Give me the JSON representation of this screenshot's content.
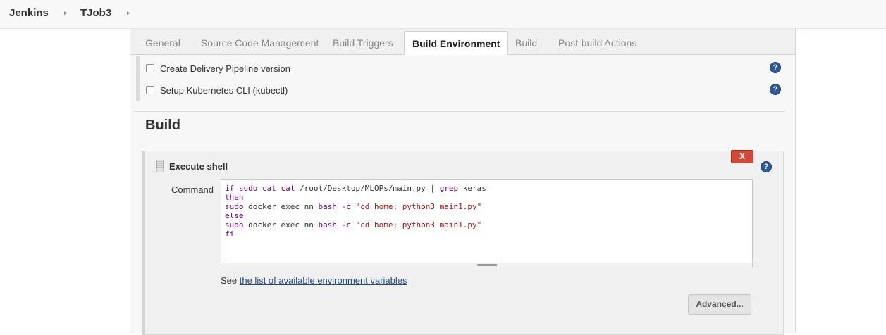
{
  "breadcrumb": {
    "items": [
      {
        "label": "Jenkins"
      },
      {
        "label": "TJob3"
      }
    ]
  },
  "tabs": [
    {
      "label": "General",
      "active": false
    },
    {
      "label": "Source Code Management",
      "active": false
    },
    {
      "label": "Build Triggers",
      "active": false
    },
    {
      "label": "Build Environment",
      "active": true
    },
    {
      "label": "Build",
      "active": false
    },
    {
      "label": "Post-build Actions",
      "active": false
    }
  ],
  "build_environment": {
    "options": [
      {
        "label": "Create Delivery Pipeline version",
        "checked": false
      },
      {
        "label": "Setup Kubernetes CLI (kubectl)",
        "checked": false
      }
    ],
    "help_icon": "?"
  },
  "build": {
    "heading": "Build",
    "step": {
      "title": "Execute shell",
      "delete_label": "X",
      "command_label": "Command",
      "command_lines": [
        "if sudo cat cat /root/Desktop/MLOPs/main.py | grep keras",
        "then",
        "sudo docker exec nn bash -c \"cd home; python3 main1.py\"",
        "else",
        "sudo docker exec nn bash -c \"cd home; python3 main1.py\"",
        "fi"
      ],
      "see_prefix": "See ",
      "env_link": "the list of available environment variables",
      "advanced_label": "Advanced..."
    }
  },
  "colors": {
    "delete_button": "#d24939",
    "help_icon": "#2f5a99",
    "link": "#204a87",
    "keyword": "#770088",
    "string": "#aa1111"
  }
}
